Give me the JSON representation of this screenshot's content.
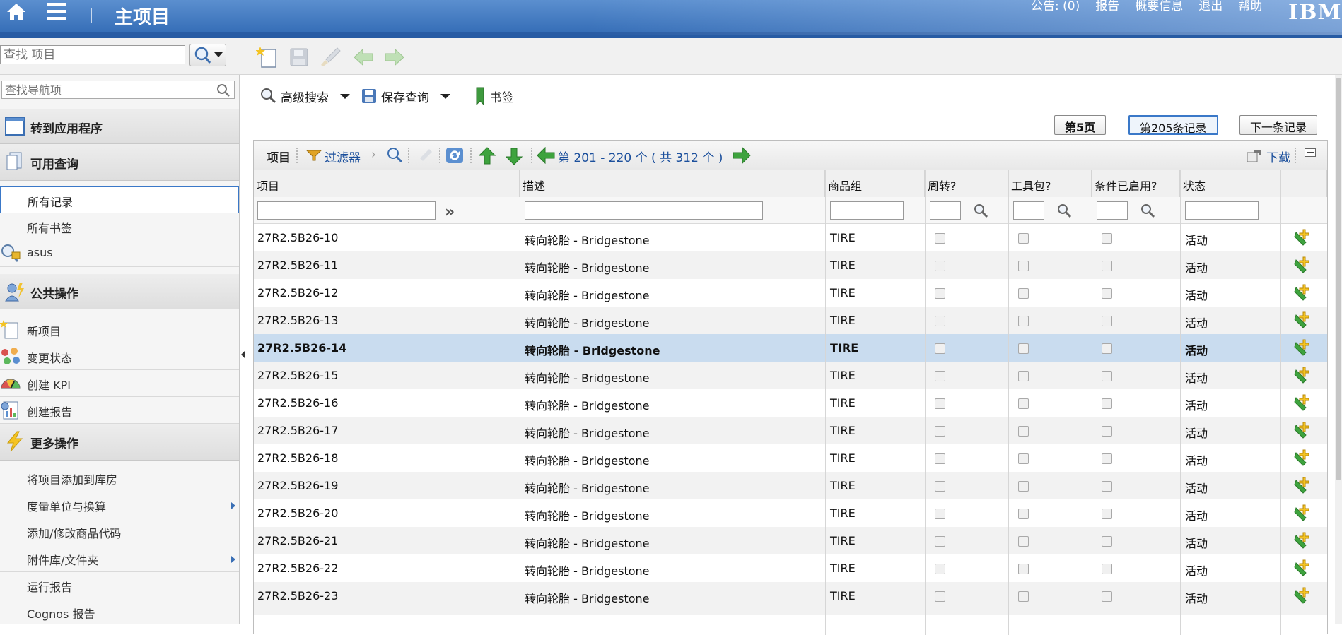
{
  "banner": {
    "title": "主项目",
    "links": [
      "公告: (0)",
      "报告",
      "概要信息",
      "退出",
      "帮助"
    ],
    "brand": "IBM."
  },
  "toolbar": {
    "find_placeholder": "查找 项目",
    "icons": [
      "new-record-icon",
      "save-icon",
      "clear-changes-icon",
      "previous-record-icon",
      "next-record-icon"
    ]
  },
  "sidebar": {
    "search_placeholder": "查找导航项",
    "sections": {
      "goto": "转到应用程序",
      "queries": "可用查询",
      "common": "公共操作",
      "more": "更多操作"
    },
    "query_items": [
      "所有记录",
      "所有书签",
      "asus"
    ],
    "common_items": [
      "新项目",
      "变更状态",
      "创建 KPI",
      "创建报告"
    ],
    "more_items": [
      "将项目添加到库房",
      "度量单位与换算",
      "添加/修改商品代码",
      "附件库/文件夹",
      "运行报告",
      "Cognos 报告"
    ]
  },
  "query_bar": {
    "advanced_search": "高级搜索",
    "save_query": "保存查询",
    "bookmark": "书签"
  },
  "paging": {
    "page": "第5页",
    "record": "第205条记录",
    "next": "下一条记录"
  },
  "table": {
    "title": "项目",
    "filter": "过滤器",
    "range": "第 201 - 220 个 ( 共 312 个 )",
    "download": "下载",
    "columns": [
      "项目",
      "描述",
      "商品组",
      "周转?",
      "工具包?",
      "条件已启用?",
      "状态"
    ],
    "rows": [
      {
        "item": "27R2.5B26-10",
        "desc": "转向轮胎  -  Bridgestone",
        "group": "TIRE",
        "status": "活动"
      },
      {
        "item": "27R2.5B26-11",
        "desc": "转向轮胎  -  Bridgestone",
        "group": "TIRE",
        "status": "活动"
      },
      {
        "item": "27R2.5B26-12",
        "desc": "转向轮胎  -  Bridgestone",
        "group": "TIRE",
        "status": "活动"
      },
      {
        "item": "27R2.5B26-13",
        "desc": "转向轮胎  -  Bridgestone",
        "group": "TIRE",
        "status": "活动"
      },
      {
        "item": "27R2.5B26-14",
        "desc": "转向轮胎  -  Bridgestone",
        "group": "TIRE",
        "status": "活动"
      },
      {
        "item": "27R2.5B26-15",
        "desc": "转向轮胎  -  Bridgestone",
        "group": "TIRE",
        "status": "活动"
      },
      {
        "item": "27R2.5B26-16",
        "desc": "转向轮胎  -  Bridgestone",
        "group": "TIRE",
        "status": "活动"
      },
      {
        "item": "27R2.5B26-17",
        "desc": "转向轮胎  -  Bridgestone",
        "group": "TIRE",
        "status": "活动"
      },
      {
        "item": "27R2.5B26-18",
        "desc": "转向轮胎  -  Bridgestone",
        "group": "TIRE",
        "status": "活动"
      },
      {
        "item": "27R2.5B26-19",
        "desc": "转向轮胎  -  Bridgestone",
        "group": "TIRE",
        "status": "活动"
      },
      {
        "item": "27R2.5B26-20",
        "desc": "转向轮胎  -  Bridgestone",
        "group": "TIRE",
        "status": "活动"
      },
      {
        "item": "27R2.5B26-21",
        "desc": "转向轮胎  -  Bridgestone",
        "group": "TIRE",
        "status": "活动"
      },
      {
        "item": "27R2.5B26-22",
        "desc": "转向轮胎  -  Bridgestone",
        "group": "TIRE",
        "status": "活动"
      },
      {
        "item": "27R2.5B26-23",
        "desc": "转向轮胎  -  Bridgestone",
        "group": "TIRE",
        "status": "活动"
      }
    ],
    "selected_index": 4
  }
}
